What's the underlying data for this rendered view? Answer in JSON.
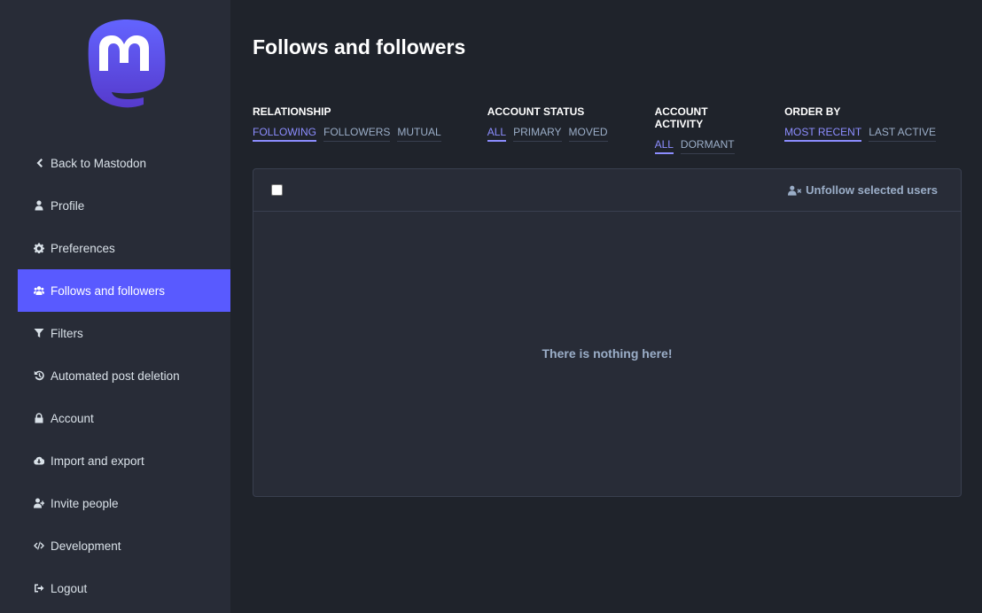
{
  "sidebar": {
    "brand_color": "#6364ff",
    "items": [
      {
        "label": "Back to Mastodon",
        "icon": "chevron-left-icon"
      },
      {
        "label": "Profile",
        "icon": "user-icon"
      },
      {
        "label": "Preferences",
        "icon": "gear-icon"
      },
      {
        "label": "Follows and followers",
        "icon": "users-icon",
        "active": true
      },
      {
        "label": "Filters",
        "icon": "filter-icon"
      },
      {
        "label": "Automated post deletion",
        "icon": "history-icon"
      },
      {
        "label": "Account",
        "icon": "lock-icon"
      },
      {
        "label": "Import and export",
        "icon": "cloud-download-icon"
      },
      {
        "label": "Invite people",
        "icon": "user-plus-icon"
      },
      {
        "label": "Development",
        "icon": "code-icon"
      },
      {
        "label": "Logout",
        "icon": "sign-out-icon"
      }
    ]
  },
  "main": {
    "title": "Follows and followers",
    "filters": [
      {
        "label": "Relationship",
        "options": [
          "Following",
          "Followers",
          "Mutual"
        ],
        "selected": "Following"
      },
      {
        "label": "Account status",
        "options": [
          "All",
          "Primary",
          "Moved"
        ],
        "selected": "All"
      },
      {
        "label": "Account activity",
        "options": [
          "All",
          "Dormant"
        ],
        "selected": "All"
      },
      {
        "label": "Order by",
        "options": [
          "Most recent",
          "Last active"
        ],
        "selected": "Most recent"
      }
    ],
    "panel": {
      "unfollow_label": "Unfollow selected users",
      "empty_message": "There is nothing here!"
    },
    "accent_color": "#8c8dff"
  }
}
